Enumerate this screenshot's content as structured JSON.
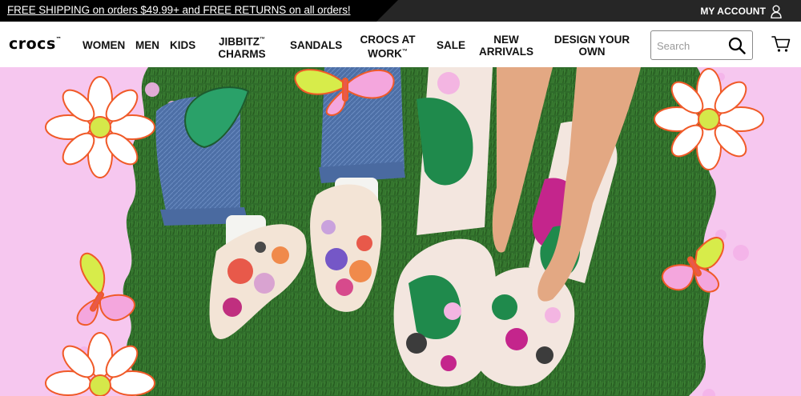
{
  "promo": {
    "text": "FREE SHIPPING on orders $49.99+ and FREE RETURNS on all orders!"
  },
  "account": {
    "label": "MY ACCOUNT",
    "icon": "user-icon"
  },
  "brand": {
    "logo_text": "crocs",
    "logo_mark": "™"
  },
  "nav": {
    "items": [
      {
        "label": "WOMEN"
      },
      {
        "label": "MEN"
      },
      {
        "label": "KIDS"
      },
      {
        "line1": "JIBBITZ",
        "mark": "™",
        "line2": "CHARMS"
      },
      {
        "label": "SANDALS"
      },
      {
        "line1": "CROCS AT",
        "line2": "WORK",
        "mark": "™"
      },
      {
        "label": "SALE"
      },
      {
        "line1": "NEW",
        "line2": "ARRIVALS"
      },
      {
        "line1": "DESIGN YOUR",
        "line2": "OWN"
      }
    ]
  },
  "search": {
    "placeholder": "Search",
    "value": "",
    "icon": "search-icon"
  },
  "cart": {
    "icon": "cart-icon"
  },
  "colors": {
    "promo_bg": "#000000",
    "hero_bg": "#f6c7ef",
    "turf": "#2e6b2a",
    "accent_green": "#1f8a4c"
  }
}
